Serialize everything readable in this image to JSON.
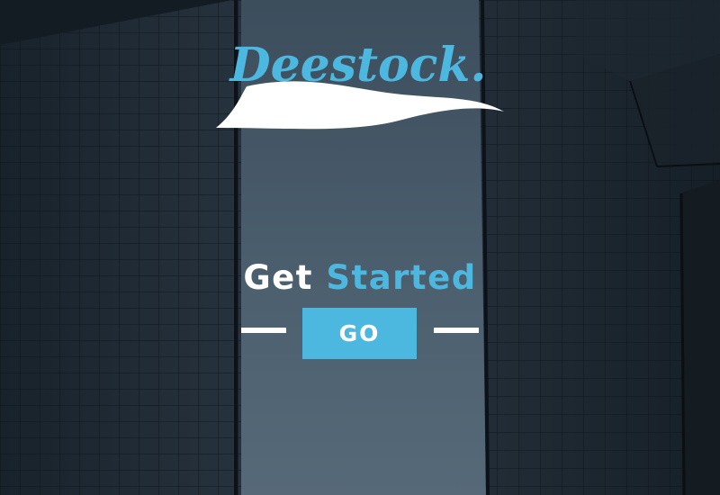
{
  "brand": {
    "name": "Deestock.",
    "logo_icon": "script-wordmark-with-swoosh",
    "accent_color": "#4cb8e0"
  },
  "hero": {
    "headline_part1": "Get",
    "headline_part2": "Started",
    "go_label": "GO"
  },
  "colors": {
    "background": "#1b2530",
    "center_sky": "#4e6170",
    "text_white": "#ffffff",
    "accent": "#4cb8e0"
  }
}
